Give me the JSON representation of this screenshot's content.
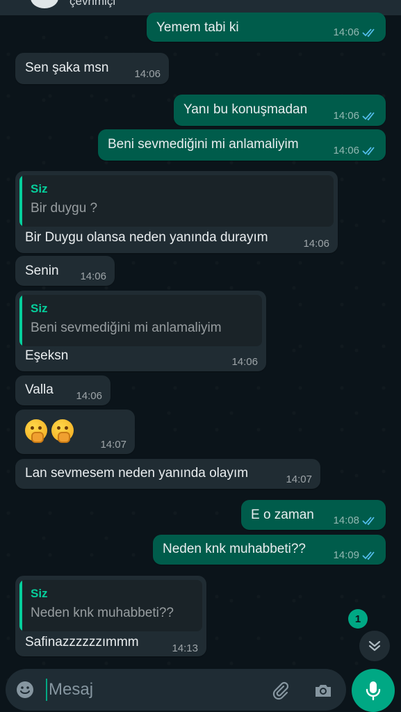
{
  "header": {
    "status": "çevrimiçi"
  },
  "messages": [
    {
      "text": "Yemem tabi ki",
      "time": "14:06"
    },
    {
      "text": "Sen şaka msn",
      "time": "14:06"
    },
    {
      "text": "Yanı bu konuşmadan",
      "time": "14:06"
    },
    {
      "text": "Beni sevmediğini mi anlamaliyim",
      "time": "14:06"
    },
    {
      "quote_author": "Siz",
      "quote_text": "Bir duygu ?",
      "text": "Bir Duygu olansa neden yanında durayım",
      "time": "14:06"
    },
    {
      "text": "Senin",
      "time": "14:06"
    },
    {
      "quote_author": "Siz",
      "quote_text": "Beni sevmediğini mi anlamaliyim",
      "text": "Eşeksn",
      "time": "14:06"
    },
    {
      "text": "Valla",
      "time": "14:06"
    },
    {
      "text": "",
      "emojis": [
        "face-with-hand-over-mouth",
        "face-with-hand-over-mouth"
      ],
      "time": "14:07"
    },
    {
      "text": "Lan sevmesem neden yanında olayım",
      "time": "14:07"
    },
    {
      "text": "E o zaman",
      "time": "14:08"
    },
    {
      "text": "Neden knk muhabbeti??",
      "time": "14:09"
    },
    {
      "quote_author": "Siz",
      "quote_text": "Neden knk muhabbeti??",
      "text": "Safinazzzzzzımmm",
      "time": "14:13"
    }
  ],
  "unread_count": "1",
  "composer": {
    "placeholder": "Mesaj"
  },
  "colors": {
    "outgoing": "#005c4b",
    "incoming": "#202c33",
    "accent": "#00a884",
    "read_ticks": "#53bdeb"
  }
}
